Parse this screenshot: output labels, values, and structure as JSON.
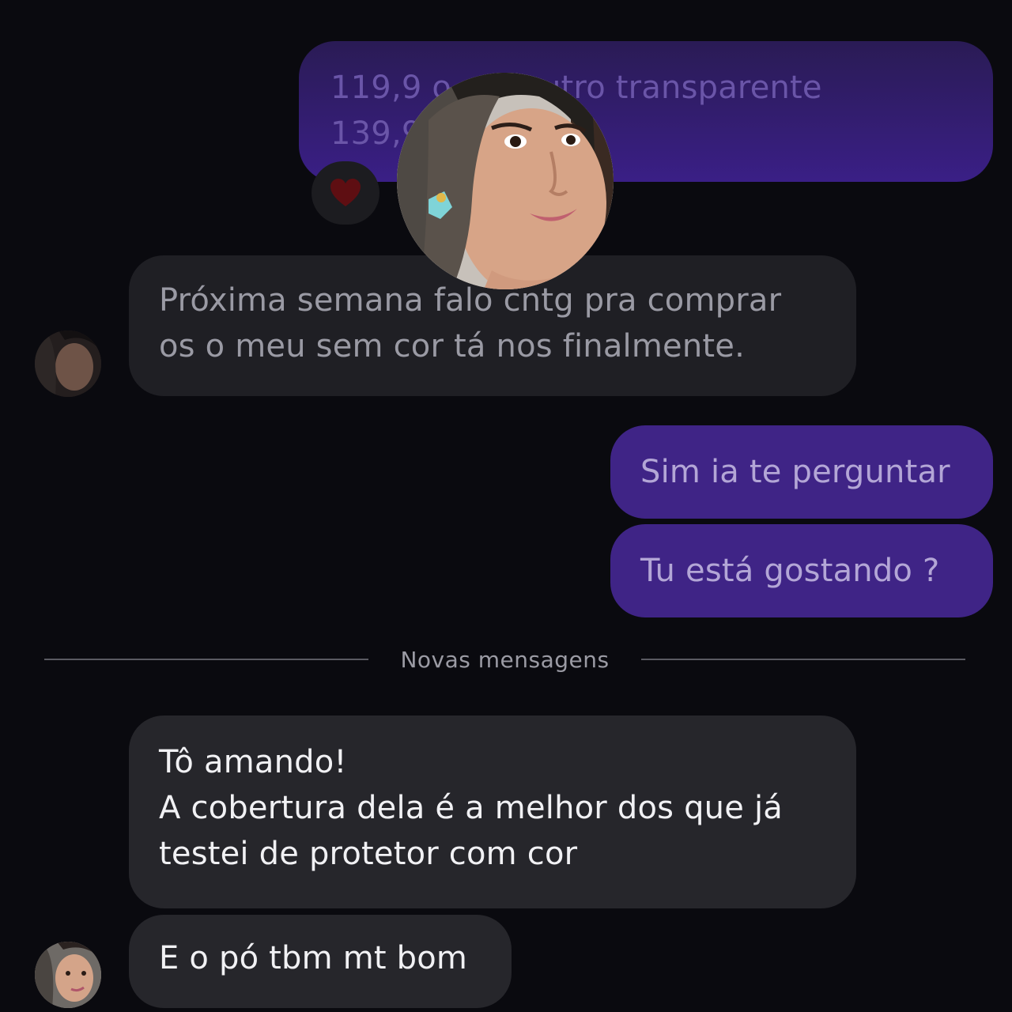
{
  "messages": {
    "top_sent": {
      "line1": "119,9 o           e o outro transparente",
      "line2": "139,9"
    },
    "proxima": {
      "line1": "Próxima semana falo cntg pra comprar",
      "line2": "os o meu sem cor tá nos finalmente."
    },
    "sim": "Sim ia te perguntar",
    "tu": "Tu está gostando ?",
    "toamando": {
      "line1": "Tô amando!",
      "line2": "A cobertura dela é a melhor dos que já",
      "line3": "testei de protetor com cor"
    },
    "po": "E o pó tbm mt bom"
  },
  "divider": {
    "label": "Novas mensagens"
  },
  "reaction": {
    "icon": "heart-icon",
    "color": "#b8141d"
  },
  "colors": {
    "sent": "#5a2dbd",
    "received": "#26262b",
    "background": "#0a0a0f"
  }
}
